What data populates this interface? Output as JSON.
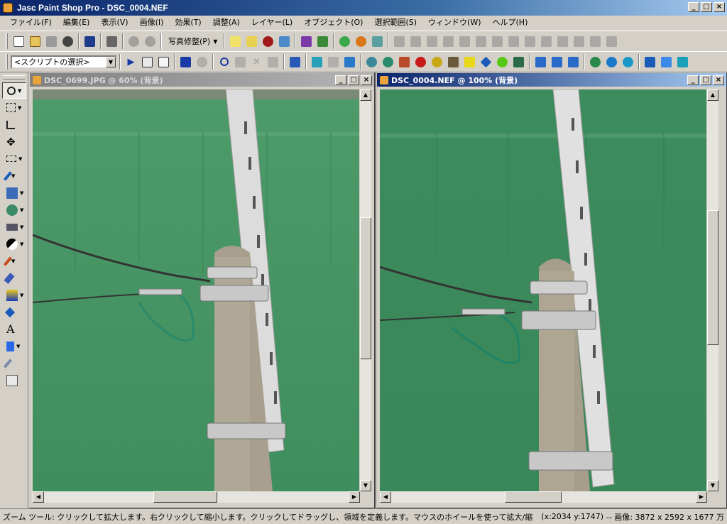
{
  "window": {
    "title": "Jasc Paint Shop Pro - DSC_0004.NEF"
  },
  "menu": [
    "ファイル(F)",
    "編集(E)",
    "表示(V)",
    "画像(I)",
    "効果(T)",
    "調整(A)",
    "レイヤー(L)",
    "オブジェクト(O)",
    "選択範囲(S)",
    "ウィンドウ(W)",
    "ヘルプ(H)"
  ],
  "toolbar1": {
    "photo_fix_label": "写真修整(P)"
  },
  "toolbar2": {
    "script_select": "<スクリプトの選択>"
  },
  "documents": [
    {
      "title": "DSC_0699.JPG @  60% (背景)"
    },
    {
      "title": "DSC_0004.NEF @ 100% (背景)"
    }
  ],
  "status": {
    "message": "ズーム ツール: クリックして拡大します。右クリックして縮小します。クリックしてドラッグし、領域を定義します。マウスのホイールを使って拡大/縮小表示します。",
    "coords": "(x:2034 y:1747)",
    "image_info": "-- 画像: 3872 x 2592 x 1677 万"
  },
  "colors": {
    "title_active": "#0a246a",
    "canvas_green": "#3c8a5c",
    "chrome": "#d4d0c8"
  }
}
